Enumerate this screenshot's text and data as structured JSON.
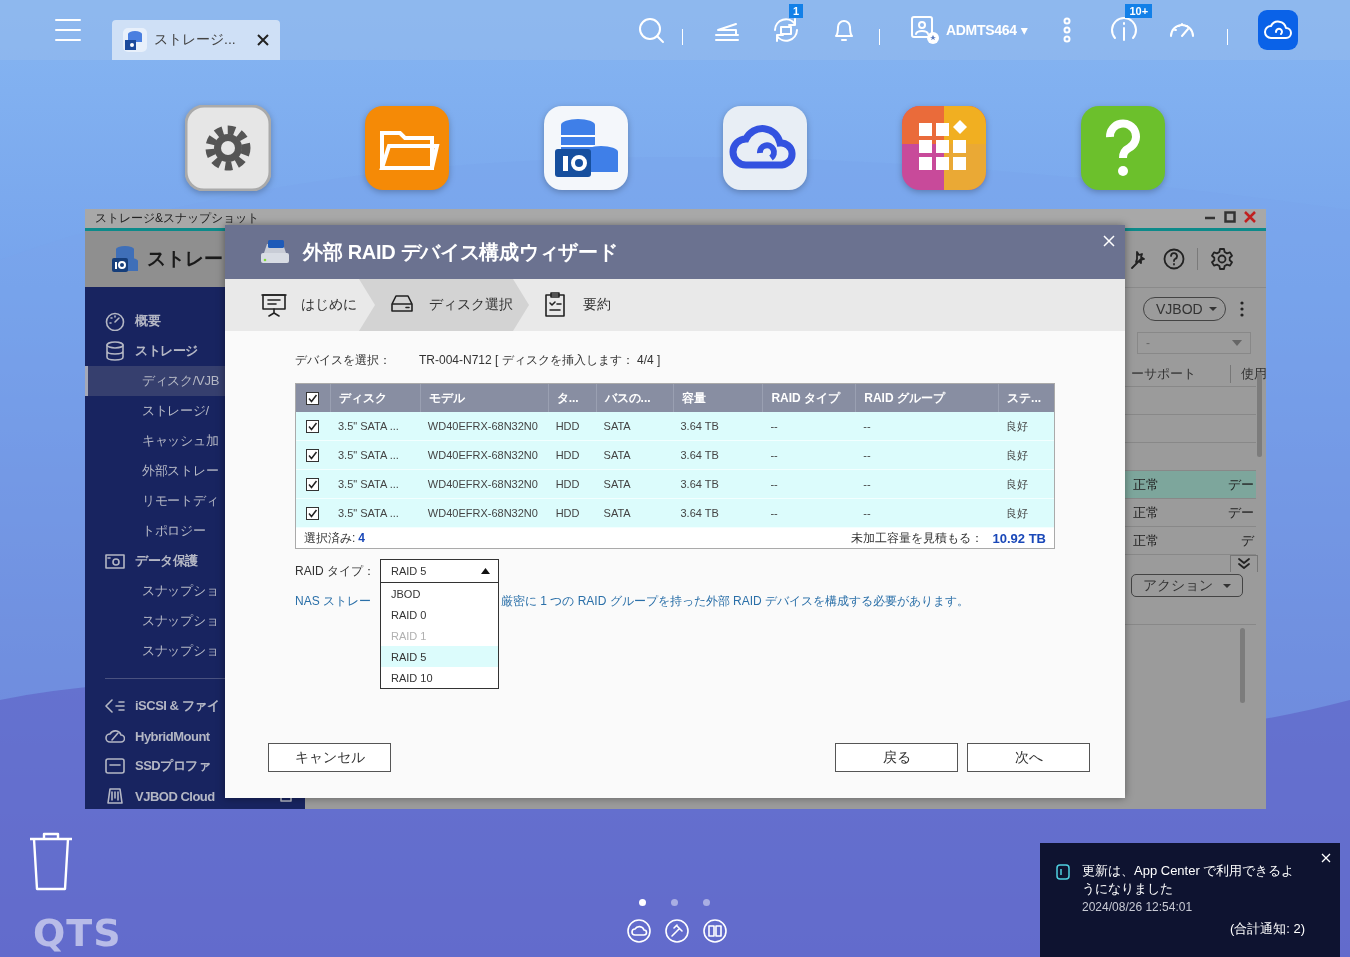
{
  "top_bar": {
    "tab_label": "ストレージ...",
    "sync_badge": "1",
    "user": "ADMTS464",
    "user_caret": "▾",
    "notice_badge": "10+"
  },
  "desktop_apps": [
    {
      "kind": "gear"
    },
    {
      "kind": "folder"
    },
    {
      "kind": "storage"
    },
    {
      "kind": "cloud"
    },
    {
      "kind": "grid"
    },
    {
      "kind": "help"
    }
  ],
  "storage_window": {
    "title": "ストレージ&スナップショット",
    "app_title": "ストレー",
    "nav": [
      {
        "label": "概要",
        "kind": "gauge"
      },
      {
        "label": "ストレージ",
        "kind": "db",
        "children": [
          {
            "label": "ディスク/VJB",
            "selected": true
          },
          {
            "label": "ストレージ/",
            "selected": false
          },
          {
            "label": "キャッシュ加",
            "selected": false
          },
          {
            "label": "外部ストレー",
            "selected": false
          },
          {
            "label": "リモートディ",
            "selected": false
          },
          {
            "label": "トポロジー",
            "selected": false
          }
        ]
      },
      {
        "label": "データ保護",
        "kind": "camera",
        "children": [
          {
            "label": "スナップショ",
            "selected": false
          },
          {
            "label": "スナップショ",
            "selected": false
          },
          {
            "label": "スナップショ",
            "selected": false
          }
        ]
      },
      {
        "label": "iSCSI & ファイ",
        "kind": "iscsi"
      },
      {
        "label": "HybridMount",
        "kind": "cloud"
      },
      {
        "label": "SSDプロファ",
        "kind": "ssd"
      },
      {
        "label": "VJBOD Cloud",
        "kind": "vjbod"
      }
    ],
    "filter": "VJBOD",
    "select": "-",
    "columns": [
      "ーサポート",
      "使用"
    ],
    "rows": [
      {
        "column_1": "正常",
        "column_2": "デー",
        "selected": true
      },
      {
        "column_1": "正常",
        "column_2": "デー",
        "selected": false
      },
      {
        "column_1": "正常",
        "column_2": "デ",
        "selected": false
      }
    ],
    "action": "アクション"
  },
  "wizard": {
    "title": "外部 RAID デバイス構成ウィザード",
    "steps": [
      {
        "label": "はじめに",
        "selected": false
      },
      {
        "label": "ディスク選択",
        "selected": true
      },
      {
        "label": "要約",
        "selected": false
      }
    ],
    "device_label": "デバイスを選択：",
    "device_value": "TR-004-N712 [ ディスクを挿入します： 4/4 ]",
    "table": {
      "all_checked": true,
      "columns": [
        "ディスク",
        "モデル",
        "タ...",
        "バスの...",
        "容量",
        "RAID タイプ",
        "RAID グループ",
        "ステ..."
      ],
      "rows": [
        {
          "checked": true,
          "cells": [
            "3.5\" SATA ...",
            "WD40EFRX-68N32N0",
            "HDD",
            "SATA",
            "3.64 TB",
            "--",
            "--",
            "良好"
          ]
        },
        {
          "checked": true,
          "cells": [
            "3.5\" SATA ...",
            "WD40EFRX-68N32N0",
            "HDD",
            "SATA",
            "3.64 TB",
            "--",
            "--",
            "良好"
          ]
        },
        {
          "checked": true,
          "cells": [
            "3.5\" SATA ...",
            "WD40EFRX-68N32N0",
            "HDD",
            "SATA",
            "3.64 TB",
            "--",
            "--",
            "良好"
          ]
        },
        {
          "checked": true,
          "cells": [
            "3.5\" SATA ...",
            "WD40EFRX-68N32N0",
            "HDD",
            "SATA",
            "3.64 TB",
            "--",
            "--",
            "良好"
          ]
        }
      ]
    },
    "selected_label": "選択済み:",
    "selected_count": "4",
    "estimate_label": "未加工容量を見積もる：",
    "estimate_value": "10.92 TB",
    "raid_label": "RAID タイプ：",
    "raid_value": "RAID 5",
    "raid_options": [
      {
        "label": "JBOD",
        "disabled": false,
        "selected": false
      },
      {
        "label": "RAID 0",
        "disabled": false,
        "selected": false
      },
      {
        "label": "RAID 1",
        "disabled": true,
        "selected": false
      },
      {
        "label": "RAID 5",
        "disabled": false,
        "selected": true
      },
      {
        "label": "RAID 10",
        "disabled": false,
        "selected": false
      }
    ],
    "note_start": "NAS ストレー",
    "note_end": "厳密に 1 つの RAID グループを持った外部 RAID デバイスを構成する必要があります。",
    "buttons": {
      "cancel": "キャンセル",
      "back": "戻る",
      "next": "次へ"
    }
  },
  "brand": "QTS",
  "pages": [
    {
      "selected": true
    },
    {
      "selected": false
    },
    {
      "selected": false
    }
  ],
  "notification": {
    "message": "更新は、App Center で利用できるようになりました",
    "time": "2024/08/26 12:54:01",
    "total": "(合計通知: 2)"
  }
}
